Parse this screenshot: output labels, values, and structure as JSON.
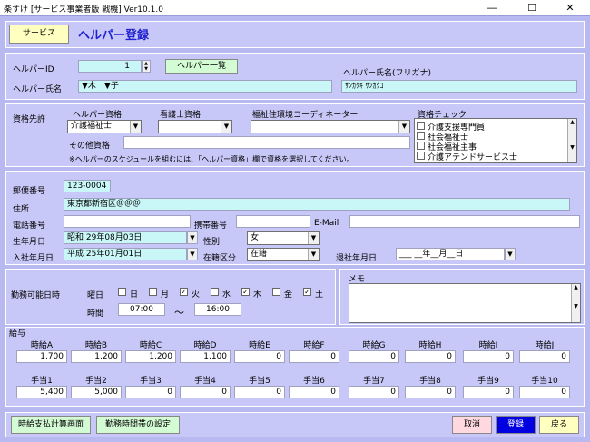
{
  "window": {
    "title": "楽すけ [サービス事業者版 戦機] Ver10.1.0"
  },
  "header": {
    "service_button": "サービス",
    "page_title": "ヘルパー登録"
  },
  "helper": {
    "id_label": "ヘルパーID",
    "id_value": "1",
    "list_button": "ヘルパー一覧",
    "name_label": "ヘルパー氏名",
    "name_value": "▼木　▼子",
    "kana_label": "ヘルパー氏名(フリガナ)",
    "kana_value": "ｻﾝｶｸｷ ｻﾝｶｸｺ"
  },
  "qualification": {
    "label": "資格先許",
    "helper_q_label": "ヘルパー資格",
    "helper_q_value": "介護福祉士",
    "nurse_label": "看護士資格",
    "nurse_value": "",
    "coord_label": "福祉住環境コーディネーター",
    "coord_value": "",
    "other_label": "その他資格",
    "other_value": "",
    "note": "※ヘルパーのスケジュールを組むには、「ヘルパー資格」欄で資格を選択してください。",
    "check_label": "資格チェック",
    "check_items": [
      "介護支援専門員",
      "社会福祉士",
      "社会福祉主事",
      "介護アテンドサービス士"
    ]
  },
  "contact": {
    "postal_label": "郵便番号",
    "postal_value": "123-0004",
    "address_label": "住所",
    "address_value": "東京都新宿区＠＠＠",
    "phone_label": "電話番号",
    "phone_value": "",
    "mobile_label": "携帯番号",
    "mobile_value": "",
    "email_label": "E-Mail",
    "email_value": "",
    "birth_label": "生年月日",
    "birth_value": "昭和 29年08月03日",
    "gender_label": "性別",
    "gender_value": "女",
    "join_label": "入社年月日",
    "join_value": "平成 25年01月01日",
    "status_label": "在籍区分",
    "status_value": "在籍",
    "retire_label": "退社年月日",
    "retire_value": "___ __年__月__日"
  },
  "schedule": {
    "label": "勤務可能日時",
    "day_label": "曜日",
    "days": [
      {
        "name": "日",
        "checked": ""
      },
      {
        "name": "月",
        "checked": ""
      },
      {
        "name": "火",
        "checked": "✓"
      },
      {
        "name": "水",
        "checked": ""
      },
      {
        "name": "木",
        "checked": "✓"
      },
      {
        "name": "金",
        "checked": ""
      },
      {
        "name": "土",
        "checked": "✓"
      }
    ],
    "time_label": "時間",
    "time_from": "07:00",
    "tilde": "～",
    "time_to": "16:00",
    "memo_label": "メモ",
    "memo_value": ""
  },
  "pay": {
    "label": "給与",
    "hourly_labels": [
      "時給A",
      "時給B",
      "時給C",
      "時給D",
      "時給E",
      "時給F",
      "時給G",
      "時給H",
      "時給I",
      "時給J"
    ],
    "hourly_values": [
      "1,700",
      "1,200",
      "1,200",
      "1,100",
      "0",
      "0",
      "0",
      "0",
      "0",
      "0"
    ],
    "allow_labels": [
      "手当1",
      "手当2",
      "手当3",
      "手当4",
      "手当5",
      "手当6",
      "手当7",
      "手当8",
      "手当9",
      "手当10"
    ],
    "allow_values": [
      "5,400",
      "5,000",
      "0",
      "0",
      "0",
      "0",
      "0",
      "0",
      "0",
      "0"
    ]
  },
  "footer": {
    "calc_button": "時給支払計算画面",
    "shift_button": "勤務時間帯の設定",
    "cancel_button": "取消",
    "register_button": "登録",
    "back_button": "戻る"
  },
  "colors": {
    "background": "#b9b9f2",
    "panel": "#c8c8f8",
    "field": "#c9f7f7",
    "title": "#2020d0",
    "register": "#0000e0"
  }
}
